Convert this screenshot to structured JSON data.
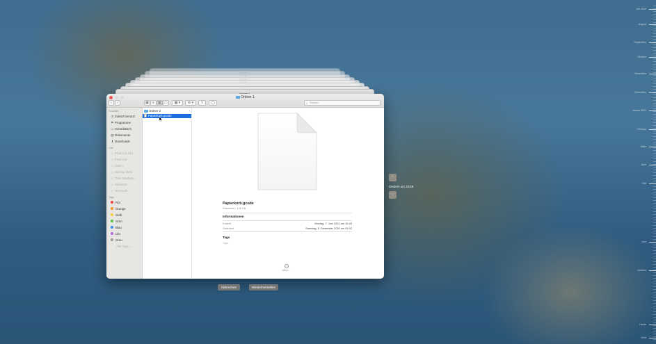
{
  "stacked_windows": [
    {
      "title": "Ordner 1"
    },
    {
      "title": "Ordner 1"
    },
    {
      "title": "Ordner 1"
    },
    {
      "title": "Ordner 1"
    },
    {
      "title": "Ordner 1"
    },
    {
      "title": "Ordner 1"
    },
    {
      "title": "Ordner 1"
    },
    {
      "title": "Ordner 1"
    }
  ],
  "window": {
    "title": "Ordner 1",
    "search_placeholder": "Suchen"
  },
  "sidebar": {
    "favorites_header": "Favoriten",
    "favorites": [
      {
        "label": "Zuletzt benutzt",
        "icon": "clock-icon"
      },
      {
        "label": "Programme",
        "icon": "apps-icon"
      },
      {
        "label": "Schreibtisch",
        "icon": "desktop-icon"
      },
      {
        "label": "Dokumente",
        "icon": "document-icon"
      },
      {
        "label": "Downloads",
        "icon": "download-icon"
      }
    ],
    "locations_header": "Orte",
    "locations": [
      {
        "label": "Final Cut Libr..."
      },
      {
        "label": "Final Cut"
      },
      {
        "label": "Daten"
      },
      {
        "label": "Backup MAC"
      },
      {
        "label": "Time Machine..."
      },
      {
        "label": "Windows"
      },
      {
        "label": "Netzwerk"
      }
    ],
    "tags_header": "Tags",
    "tags": [
      {
        "label": "Rot",
        "color": "#f0473d"
      },
      {
        "label": "Orange",
        "color": "#f49a2b"
      },
      {
        "label": "Gelb",
        "color": "#f7cf37"
      },
      {
        "label": "Grün",
        "color": "#5ec447"
      },
      {
        "label": "Blau",
        "color": "#3a8cf0"
      },
      {
        "label": "Lila",
        "color": "#b66ad9"
      },
      {
        "label": "Grau",
        "color": "#9b9b9b"
      }
    ],
    "all_tags": "Alle Tags ..."
  },
  "column": {
    "items": [
      {
        "name": "Ordner 2",
        "selected": false
      },
      {
        "name": "Papierkorb.gcode",
        "selected": true
      }
    ]
  },
  "preview": {
    "filename": "Papierkorb.gcode",
    "subtitle": "Dokument - 142 KB",
    "info_header": "Informationen",
    "created_label": "Erstellt",
    "created_value": "Montag, 7. Juni 2021 um 15:43",
    "modified_label": "Geändert",
    "modified_value": "Samstag, 5. Dezember 2020 um 01:02",
    "tags_header": "Tags",
    "tags_placeholder": "Tags ...",
    "more_label": "Mehr ..."
  },
  "buttons": {
    "cancel": "Abbrechen",
    "restore": "Wiederherstellen"
  },
  "time_machine": {
    "date_label": "Gestern um 23:58"
  },
  "timeline": [
    "Juli 2020",
    "August",
    "September",
    "Oktober",
    "November",
    "Dezember",
    "Januar 2021",
    "Februar",
    "März",
    "April",
    "Mai",
    "Juni",
    "Gestern",
    "Heute",
    "Jetzt"
  ]
}
